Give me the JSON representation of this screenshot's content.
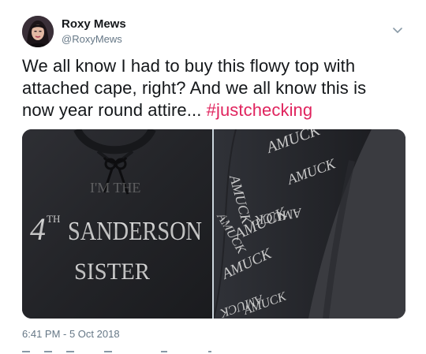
{
  "author": {
    "display_name": "Roxy Mews",
    "handle": "@RoxyMews"
  },
  "tweet": {
    "text": "We all know I had to buy this flowy top with attached cape, right? And we all know this is now year round attire...",
    "hashtag": "#justchecking",
    "timestamp": "6:41 PM - 5 Oct 2018"
  },
  "media": {
    "left_photo": {
      "print_line1_prefix": "4",
      "print_line1_sup": "TH",
      "print_line1_word": "SANDERSON",
      "print_line2": "SISTER",
      "print_faded": "I'M THE"
    },
    "right_photo": {
      "print_word": "AMUCK"
    }
  },
  "icons": {
    "caret": "chevron-down-icon"
  },
  "colors": {
    "hashtag": "#e0245e",
    "secondary_text": "#657786",
    "shirt": "#232428",
    "print": "#d9d9d9"
  }
}
